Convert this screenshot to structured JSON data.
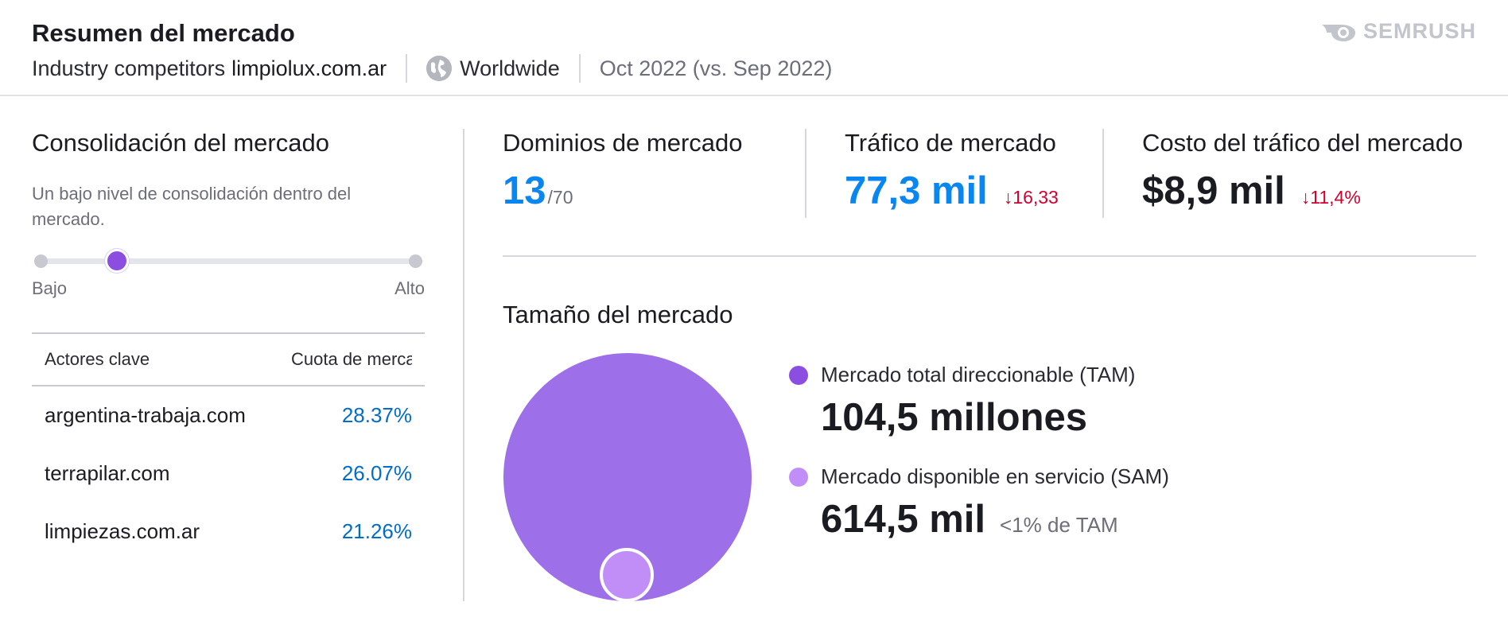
{
  "header": {
    "title": "Resumen del mercado",
    "subtitle_prefix": "Industry competitors",
    "domain": "limpiolux.com.ar",
    "region": "Worldwide",
    "period": "Oct 2022 (vs. Sep 2022)",
    "logo_text": "SEMRUSH"
  },
  "consolidation": {
    "title": "Consolidación del mercado",
    "description": "Un bajo nivel de consolidación dentro del mercado.",
    "slider_level": 0.2,
    "low_label": "Bajo",
    "high_label": "Alto"
  },
  "players_table": {
    "columns": [
      "Actores clave",
      "Cuota de mercado"
    ],
    "rows": [
      {
        "domain": "argentina-trabaja.com",
        "share": "28.37%"
      },
      {
        "domain": "terrapilar.com",
        "share": "26.07%"
      },
      {
        "domain": "limpiezas.com.ar",
        "share": "21.26%"
      }
    ]
  },
  "metrics": {
    "domains": {
      "label": "Dominios de mercado",
      "value": "13",
      "total": "/70"
    },
    "traffic": {
      "label": "Tráfico de mercado",
      "value": "77,3 mil",
      "delta": "↓16,33"
    },
    "cost": {
      "label": "Costo del tráfico del mercado",
      "value": "$8,9 mil",
      "delta": "↓11,4%"
    }
  },
  "market_size": {
    "title": "Tamaño del mercado",
    "tam": {
      "label": "Mercado total direccionable (TAM)",
      "value": "104,5 millones",
      "color": "#9d6fe8"
    },
    "sam": {
      "label": "Mercado disponible en servicio (SAM)",
      "value": "614,5 mil",
      "note": "<1% de TAM",
      "color": "#c18ef7"
    }
  },
  "colors": {
    "accent_blue": "#0a86f0",
    "link_blue": "#006dca",
    "negative_red": "#d1002f",
    "purple": "#8b4ee0"
  }
}
